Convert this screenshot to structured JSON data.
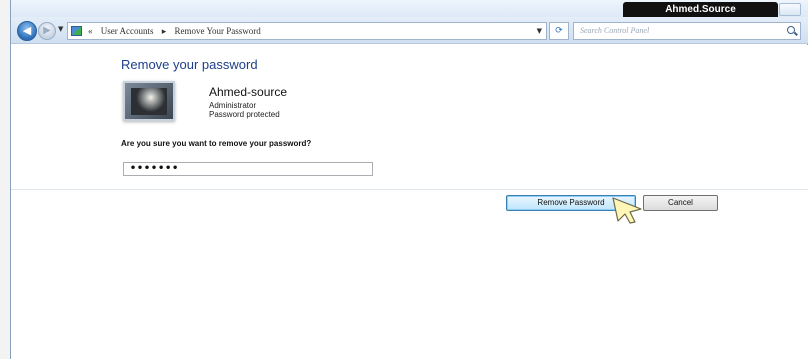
{
  "window": {
    "user_badge": "Ahmed.Source"
  },
  "address_bar": {
    "crumbs": [
      "«",
      "User Accounts",
      "▸",
      "Remove Your Password"
    ],
    "search_placeholder": "Search Control Panel"
  },
  "content": {
    "title": "Remove your password",
    "user": {
      "name": "Ahmed-source",
      "role": "Administrator",
      "status": "Password protected"
    },
    "question": "Are you sure you want to remove your password?",
    "password_value": "•••••••"
  },
  "actions": {
    "remove_label": "Remove Password",
    "cancel_label": "Cancel"
  },
  "colors": {
    "title_blue": "#1e3f8a",
    "primary_button_border": "#3c7fb1"
  }
}
